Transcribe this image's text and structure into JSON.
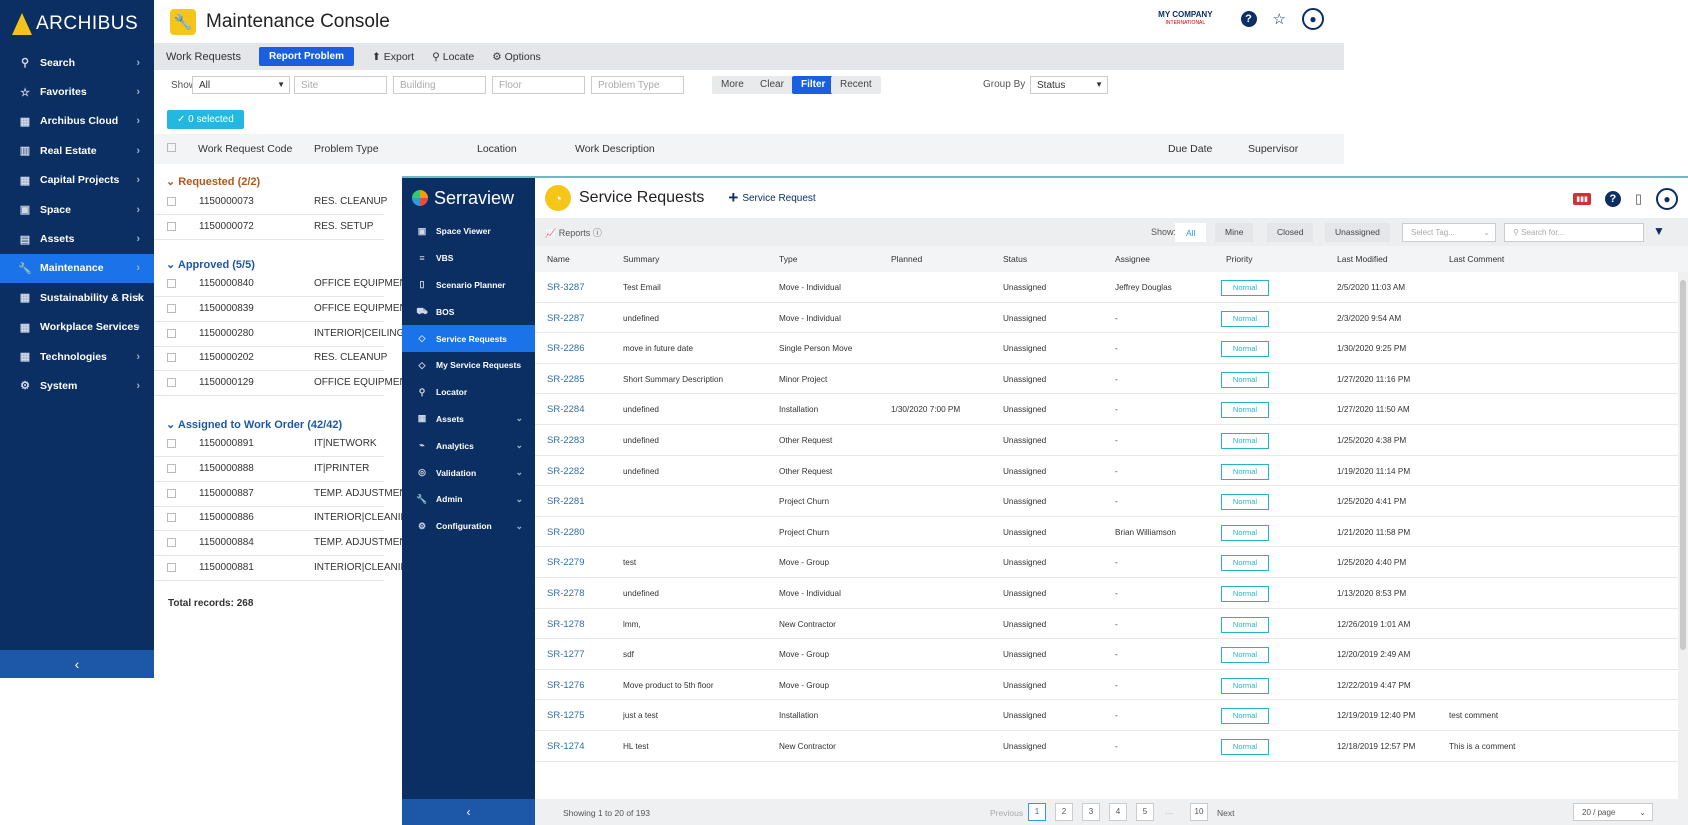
{
  "archibus": {
    "logo": "ARCHIBUS",
    "nav": [
      {
        "icon": "search-icon",
        "label": "Search"
      },
      {
        "icon": "star-icon",
        "label": "Favorites"
      },
      {
        "icon": "grid-icon",
        "label": "Archibus Cloud"
      },
      {
        "icon": "building-icon",
        "label": "Real Estate"
      },
      {
        "icon": "grid-icon",
        "label": "Capital Projects"
      },
      {
        "icon": "floorplan-icon",
        "label": "Space"
      },
      {
        "icon": "clipboard-icon",
        "label": "Assets"
      },
      {
        "icon": "wrench-icon",
        "label": "Maintenance"
      },
      {
        "icon": "grid-icon",
        "label": "Sustainability & Risk"
      },
      {
        "icon": "calendar-icon",
        "label": "Workplace Services"
      },
      {
        "icon": "grid-icon",
        "label": "Technologies"
      },
      {
        "icon": "gear-icon",
        "label": "System"
      }
    ],
    "title": "Maintenance Console",
    "company": "MY COMPANY",
    "company_sub": "INTERNATIONAL",
    "toolbar": {
      "work_requests": "Work Requests",
      "report_problem": "Report Problem",
      "export": "Export",
      "locate": "Locate",
      "options": "Options"
    },
    "filter": {
      "show_label": "Show",
      "show_value": "All",
      "site": "Site",
      "building": "Building",
      "floor": "Floor",
      "problem_type": "Problem Type",
      "more": "More",
      "clear": "Clear",
      "filter": "Filter",
      "recent": "Recent",
      "group_by_label": "Group By",
      "group_by_value": "Status"
    },
    "selected": "0 selected",
    "columns": {
      "code": "Work Request Code",
      "problem": "Problem Type",
      "location": "Location",
      "description": "Work Description",
      "due": "Due Date",
      "supervisor": "Supervisor"
    },
    "groups": {
      "requested": "Requested (2/2)",
      "approved": "Approved (5/5)",
      "assigned": "Assigned to Work Order (42/42)"
    },
    "rows_requested": [
      {
        "code": "1150000073",
        "type": "RES. CLEANUP"
      },
      {
        "code": "1150000072",
        "type": "RES. SETUP"
      }
    ],
    "rows_approved": [
      {
        "code": "1150000840",
        "type": "OFFICE EQUIPMENT|"
      },
      {
        "code": "1150000839",
        "type": "OFFICE EQUIPMENT|"
      },
      {
        "code": "1150000280",
        "type": "INTERIOR|CEILING"
      },
      {
        "code": "1150000202",
        "type": "RES. CLEANUP"
      },
      {
        "code": "1150000129",
        "type": "OFFICE EQUIPMENT"
      }
    ],
    "rows_assigned": [
      {
        "code": "1150000891",
        "type": "IT|NETWORK"
      },
      {
        "code": "1150000888",
        "type": "IT|PRINTER"
      },
      {
        "code": "1150000887",
        "type": "TEMP. ADJUSTMENT"
      },
      {
        "code": "1150000886",
        "type": "INTERIOR|CLEANING"
      },
      {
        "code": "1150000884",
        "type": "TEMP. ADJUSTMENT"
      },
      {
        "code": "1150000881",
        "type": "INTERIOR|CLEANING"
      }
    ],
    "total": "Total records: 268"
  },
  "serraview": {
    "logo": "Serraview",
    "nav": [
      {
        "icon": "floorplan-icon",
        "label": "Space Viewer",
        "chev": ""
      },
      {
        "icon": "list-icon",
        "label": "VBS",
        "chev": ""
      },
      {
        "icon": "document-icon",
        "label": "Scenario Planner",
        "chev": ""
      },
      {
        "icon": "truck-icon",
        "label": "BOS",
        "chev": ""
      },
      {
        "icon": "diamond-icon",
        "label": "Service Requests",
        "chev": ""
      },
      {
        "icon": "diamond-icon",
        "label": "My Service Requests",
        "chev": ""
      },
      {
        "icon": "search-icon",
        "label": "Locator",
        "chev": ""
      },
      {
        "icon": "grid-icon",
        "label": "Assets",
        "chev": "⌄"
      },
      {
        "icon": "chart-icon",
        "label": "Analytics",
        "chev": "⌄"
      },
      {
        "icon": "check-circle-icon",
        "label": "Validation",
        "chev": "⌄"
      },
      {
        "icon": "wrench-icon",
        "label": "Admin",
        "chev": "⌄"
      },
      {
        "icon": "gear-icon",
        "label": "Configuration",
        "chev": "⌄"
      }
    ],
    "title": "Service Requests",
    "new_request": "Service Request",
    "toolbar": {
      "reports": "Reports",
      "show": "Show:",
      "all": "All",
      "mine": "Mine",
      "closed": "Closed",
      "unassigned": "Unassigned",
      "tag_placeholder": "Select Tag...",
      "search_placeholder": "Search for..."
    },
    "columns": {
      "name": "Name",
      "summary": "Summary",
      "type": "Type",
      "planned": "Planned",
      "status": "Status",
      "assignee": "Assignee",
      "priority": "Priority",
      "modified": "Last Modified",
      "comment": "Last Comment"
    },
    "rows": [
      {
        "name": "SR-3287",
        "summary": "Test Email",
        "type": "Move - Individual",
        "planned": "",
        "status": "Unassigned",
        "assignee": "Jeffrey Douglas",
        "priority": "Normal",
        "modified": "2/5/2020 11:03 AM",
        "comment": ""
      },
      {
        "name": "SR-2287",
        "summary": "undefined",
        "type": "Move - Individual",
        "planned": "",
        "status": "Unassigned",
        "assignee": "-",
        "priority": "Normal",
        "modified": "2/3/2020 9:54 AM",
        "comment": ""
      },
      {
        "name": "SR-2286",
        "summary": "move in future date",
        "type": "Single Person Move",
        "planned": "",
        "status": "Unassigned",
        "assignee": "-",
        "priority": "Normal",
        "modified": "1/30/2020 9:25 PM",
        "comment": ""
      },
      {
        "name": "SR-2285",
        "summary": "Short Summary Description",
        "type": "Minor Project",
        "planned": "",
        "status": "Unassigned",
        "assignee": "-",
        "priority": "Normal",
        "modified": "1/27/2020 11:16 PM",
        "comment": ""
      },
      {
        "name": "SR-2284",
        "summary": "undefined",
        "type": "Installation",
        "planned": "1/30/2020 7:00 PM",
        "status": "Unassigned",
        "assignee": "-",
        "priority": "Normal",
        "modified": "1/27/2020 11:50 AM",
        "comment": ""
      },
      {
        "name": "SR-2283",
        "summary": "undefined",
        "type": "Other Request",
        "planned": "",
        "status": "Unassigned",
        "assignee": "-",
        "priority": "Normal",
        "modified": "1/25/2020 4:38 PM",
        "comment": ""
      },
      {
        "name": "SR-2282",
        "summary": "undefined",
        "type": "Other Request",
        "planned": "",
        "status": "Unassigned",
        "assignee": "-",
        "priority": "Normal",
        "modified": "1/19/2020 11:14 PM",
        "comment": ""
      },
      {
        "name": "SR-2281",
        "summary": "",
        "type": "Project Churn",
        "planned": "",
        "status": "Unassigned",
        "assignee": "-",
        "priority": "Normal",
        "modified": "1/25/2020 4:41 PM",
        "comment": ""
      },
      {
        "name": "SR-2280",
        "summary": "",
        "type": "Project Churn",
        "planned": "",
        "status": "Unassigned",
        "assignee": "Brian Williamson",
        "priority": "Normal",
        "modified": "1/21/2020 11:58 PM",
        "comment": ""
      },
      {
        "name": "SR-2279",
        "summary": "test",
        "type": "Move - Group",
        "planned": "",
        "status": "Unassigned",
        "assignee": "-",
        "priority": "Normal",
        "modified": "1/25/2020 4:40 PM",
        "comment": ""
      },
      {
        "name": "SR-2278",
        "summary": "undefined",
        "type": "Move - Individual",
        "planned": "",
        "status": "Unassigned",
        "assignee": "-",
        "priority": "Normal",
        "modified": "1/13/2020 8:53 PM",
        "comment": ""
      },
      {
        "name": "SR-1278",
        "summary": "lmm,",
        "type": "New Contractor",
        "planned": "",
        "status": "Unassigned",
        "assignee": "-",
        "priority": "Normal",
        "modified": "12/26/2019 1:01 AM",
        "comment": ""
      },
      {
        "name": "SR-1277",
        "summary": "sdf",
        "type": "Move - Group",
        "planned": "",
        "status": "Unassigned",
        "assignee": "-",
        "priority": "Normal",
        "modified": "12/20/2019 2:49 AM",
        "comment": ""
      },
      {
        "name": "SR-1276",
        "summary": "Move product to 5th floor",
        "type": "Move - Group",
        "planned": "",
        "status": "Unassigned",
        "assignee": "-",
        "priority": "Normal",
        "modified": "12/22/2019 4:47 PM",
        "comment": ""
      },
      {
        "name": "SR-1275",
        "summary": "just a test",
        "type": "Installation",
        "planned": "",
        "status": "Unassigned",
        "assignee": "-",
        "priority": "Normal",
        "modified": "12/19/2019 12:40 PM",
        "comment": "test comment"
      },
      {
        "name": "SR-1274",
        "summary": "HL test",
        "type": "New Contractor",
        "planned": "",
        "status": "Unassigned",
        "assignee": "-",
        "priority": "Normal",
        "modified": "12/18/2019 12:57 PM",
        "comment": "This is a comment"
      }
    ],
    "footer": {
      "showing": "Showing 1 to 20 of 193",
      "previous": "Previous",
      "pages": [
        "1",
        "2",
        "3",
        "4",
        "5"
      ],
      "ellipsis": "···",
      "last": "10",
      "next": "Next",
      "per_page": "20 / page"
    }
  }
}
